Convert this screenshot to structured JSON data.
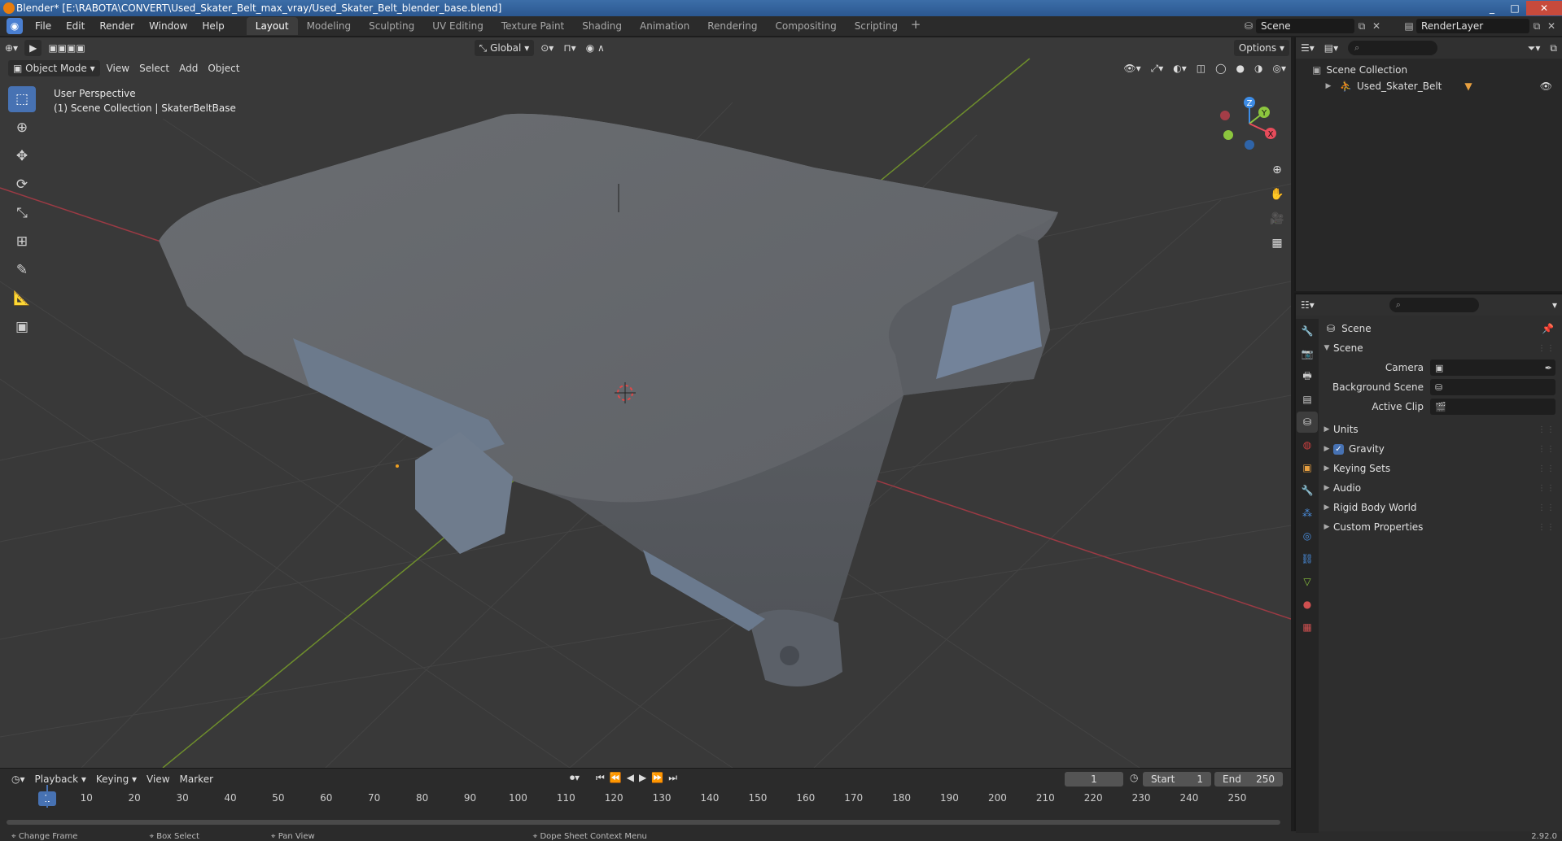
{
  "window": {
    "title": "Blender* [E:\\RABOTA\\CONVERT\\Used_Skater_Belt_max_vray/Used_Skater_Belt_blender_base.blend]",
    "minimize": "_",
    "maximize": "□",
    "close": "✕"
  },
  "menu": [
    "File",
    "Edit",
    "Render",
    "Window",
    "Help"
  ],
  "workspaces": [
    "Layout",
    "Modeling",
    "Sculpting",
    "UV Editing",
    "Texture Paint",
    "Shading",
    "Animation",
    "Rendering",
    "Compositing",
    "Scripting"
  ],
  "active_workspace": "Layout",
  "scene_selector": "Scene",
  "renderlayer_selector": "RenderLayer",
  "viewport": {
    "mode": "Object Mode",
    "menus": [
      "View",
      "Select",
      "Add",
      "Object"
    ],
    "transform": "Global",
    "options": "Options",
    "perspective": "User Perspective",
    "collection_info": "(1) Scene Collection | SkaterBeltBase",
    "gizmo_x": "X",
    "gizmo_y": "Y",
    "gizmo_z": "Z"
  },
  "timeline": {
    "menus": [
      "Playback",
      "Keying",
      "View",
      "Marker"
    ],
    "current_frame": "1",
    "start_label": "Start",
    "start": "1",
    "end_label": "End",
    "end": "250",
    "ruler": [
      "10",
      "20",
      "30",
      "40",
      "50",
      "60",
      "70",
      "80",
      "90",
      "100",
      "110",
      "120",
      "130",
      "140",
      "150",
      "160",
      "170",
      "180",
      "190",
      "200",
      "210",
      "220",
      "230",
      "240",
      "250"
    ],
    "ruler_current": "1"
  },
  "status": {
    "change_frame": "Change Frame",
    "box_select": "Box Select",
    "pan_view": "Pan View",
    "context_menu": "Dope Sheet Context Menu",
    "version": "2.92.0"
  },
  "outliner": {
    "root": "Scene Collection",
    "items": [
      "Used_Skater_Belt"
    ]
  },
  "properties": {
    "context": "Scene",
    "panel": "Scene",
    "fields": [
      {
        "label": "Camera",
        "value": ""
      },
      {
        "label": "Background Scene",
        "value": ""
      },
      {
        "label": "Active Clip",
        "value": ""
      }
    ],
    "subpanels": [
      "Units",
      "Gravity",
      "Keying Sets",
      "Audio",
      "Rigid Body World",
      "Custom Properties"
    ],
    "gravity_checked": true
  },
  "colors": {
    "accent": "#4772b3",
    "x_axis": "#e74c5b",
    "y_axis": "#8cc63e",
    "z_axis": "#3d8ce6"
  }
}
